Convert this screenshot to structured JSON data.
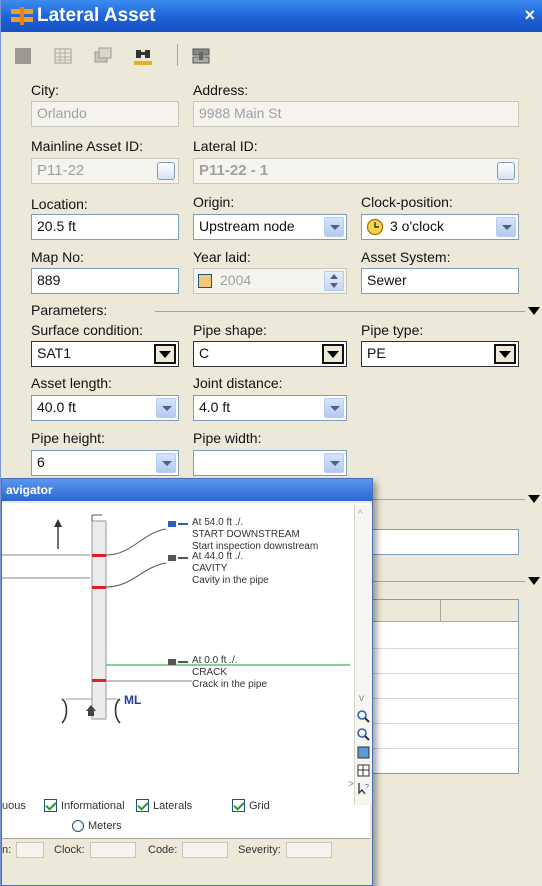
{
  "window": {
    "title": "Lateral Asset",
    "close_symbol": "×"
  },
  "toolbar": {
    "buttons": [
      "stop-icon",
      "grid-icon",
      "layers-icon",
      "binoculars-icon",
      "pipe-icon"
    ]
  },
  "fields": {
    "city": {
      "label": "City:",
      "value": "Orlando"
    },
    "address": {
      "label": "Address:",
      "value": "9988 Main St"
    },
    "mainline_id": {
      "label": "Mainline Asset ID:",
      "value": "P11-22"
    },
    "lateral_id": {
      "label": "Lateral ID:",
      "value": "P11-22 - 1"
    },
    "location": {
      "label": "Location:",
      "value": "20.5 ft"
    },
    "origin": {
      "label": "Origin:",
      "value": "Upstream node"
    },
    "clock_position": {
      "label": "Clock-position:",
      "value": "3 o'clock"
    },
    "map_no": {
      "label": "Map No:",
      "value": "889"
    },
    "year_laid": {
      "label": "Year laid:",
      "value": "2004"
    },
    "asset_system": {
      "label": "Asset System:",
      "value": "Sewer"
    }
  },
  "parameters": {
    "section_label": "Parameters:",
    "surface_condition": {
      "label": "Surface condition:",
      "value": "SAT1"
    },
    "pipe_shape": {
      "label": "Pipe shape:",
      "value": "C"
    },
    "pipe_type": {
      "label": "Pipe type:",
      "value": "PE"
    },
    "asset_length": {
      "label": "Asset length:",
      "value": "40.0 ft"
    },
    "joint_distance": {
      "label": "Joint distance:",
      "value": "4.0 ft"
    },
    "pipe_height": {
      "label": "Pipe height:",
      "value": "6"
    },
    "pipe_width": {
      "label": "Pipe width:",
      "value": ""
    }
  },
  "navigator": {
    "title": "avigator",
    "events": [
      {
        "position": "At 54.0 ft ./.",
        "code": "START DOWNSTREAM",
        "description": "Start inspection downstream"
      },
      {
        "position": "At 44.0 ft ./.",
        "code": "CAVITY",
        "description": "Cavity in the pipe"
      },
      {
        "position": "At 0.0 ft ./.",
        "code": "CRACK",
        "description": "Crack in the pipe"
      }
    ],
    "mainline_label": "ML",
    "options": {
      "continuous_fragment": "uous",
      "informational": "Informational",
      "laterals": "Laterals",
      "grid": "Grid",
      "meters": "Meters"
    },
    "footer": {
      "first_fragment": "n:",
      "clock": "Clock:",
      "code": "Code:",
      "severity": "Severity:"
    }
  },
  "colors": {
    "title_bar": "#1d5fd4",
    "window_bg": "#ece9d8",
    "defect_red": "#e02020",
    "mainline_green": "#3cb44b",
    "ml_blue": "#1a3fa0"
  }
}
